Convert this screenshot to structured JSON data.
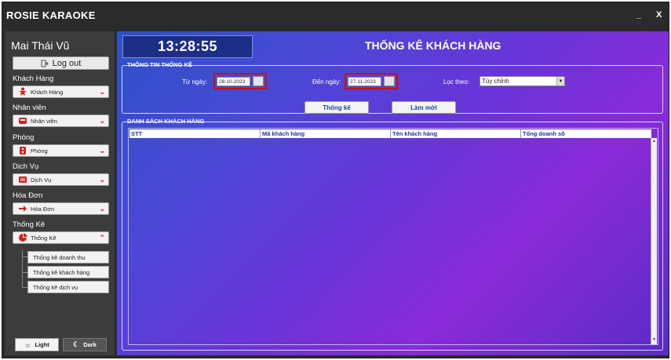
{
  "window": {
    "title": "ROSIE KARAOKE",
    "minimize": "_",
    "close": "X"
  },
  "sidebar": {
    "user_name": "Mai Thái Vũ",
    "logout_label": "Log out",
    "categories": [
      {
        "label": "Khách Hàng",
        "combo": "Khách Hàng",
        "icon": "person-icon"
      },
      {
        "label": "Nhân viên",
        "combo": "Nhân viên",
        "icon": "staff-icon"
      },
      {
        "label": "Phòng",
        "combo": "Phòng",
        "icon": "room-icon"
      },
      {
        "label": "Dịch Vụ",
        "combo": "Dịch Vụ",
        "icon": "service-icon"
      },
      {
        "label": "Hóa Đơn",
        "combo": "Hóa Đơn",
        "icon": "invoice-icon"
      },
      {
        "label": "Thống Kê",
        "combo": "Thống Kê",
        "icon": "chart-icon"
      }
    ],
    "sub_items": [
      "Thống kê doanh thu",
      "Thống kê khách hàng",
      "Thống kê dịch vụ"
    ],
    "theme_light": "Light",
    "theme_dark": "Dark"
  },
  "main": {
    "clock": "13:28:55",
    "title": "THỐNG KÊ KHÁCH HÀNG",
    "filter_group_title": "THÔNG TIN THỐNG KÊ",
    "from_label": "Từ ngày:",
    "from_value": "28-10-2023",
    "to_label": "Đến ngày:",
    "to_value": "27-11-2023",
    "filter_label": "Lọc theo:",
    "filter_value": "Tùy chỉnh",
    "stats_button": "Thống kê",
    "reset_button": "Làm mới",
    "list_group_title": "DANH SÁCH KHÁCH HÀNG",
    "columns": [
      "STT",
      "Mã khách hàng",
      "Tên khách hàng",
      "Tổng doanh số"
    ]
  },
  "colors": {
    "accent_red": "#d42020",
    "sidebar_bg": "#3c3c3c",
    "gradient_start": "#2c52c8",
    "gradient_end": "#8a2ad8"
  }
}
